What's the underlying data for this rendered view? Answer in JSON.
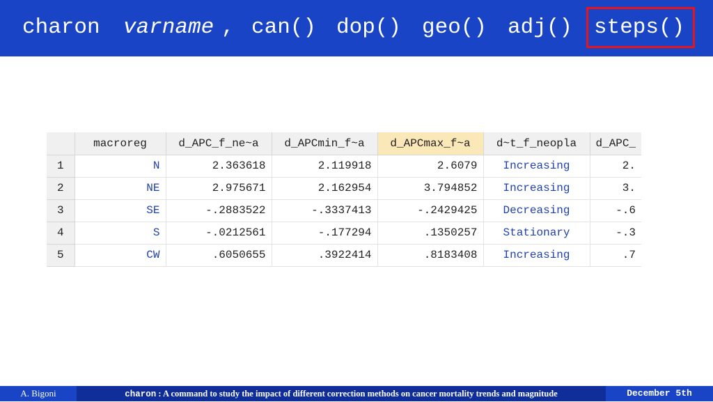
{
  "header": {
    "command": "charon",
    "varname": "varname",
    "comma": ",",
    "options": [
      "can()",
      "dop()",
      "geo()",
      "adj()",
      "steps()"
    ],
    "highlighted_option": "steps()",
    "highlight_color": "#e8141c",
    "background_color": "#1a44c6"
  },
  "table": {
    "columns": [
      "macroreg",
      "d_APC_f_ne~a",
      "d_APCmin_f~a",
      "d_APCmax_f~a",
      "d~t_f_neopla",
      "d_APC_"
    ],
    "selected_column": "d_APCmax_f~a",
    "rows": [
      {
        "num": "1",
        "macroreg": "N",
        "c1": "2.363618",
        "c2": "2.119918",
        "c3": "2.6079",
        "trend": "Increasing",
        "c5": "2."
      },
      {
        "num": "2",
        "macroreg": "NE",
        "c1": "2.975671",
        "c2": "2.162954",
        "c3": "3.794852",
        "trend": "Increasing",
        "c5": "3."
      },
      {
        "num": "3",
        "macroreg": "SE",
        "c1": "-.2883522",
        "c2": "-.3337413",
        "c3": "-.2429425",
        "trend": "Decreasing",
        "c5": "-.6"
      },
      {
        "num": "4",
        "macroreg": "S",
        "c1": "-.0212561",
        "c2": "-.177294",
        "c3": ".1350257",
        "trend": "Stationary",
        "c5": "-.3"
      },
      {
        "num": "5",
        "macroreg": "CW",
        "c1": ".6050655",
        "c2": ".3922414",
        "c3": ".8183408",
        "trend": "Increasing",
        "c5": ".7"
      }
    ]
  },
  "footer": {
    "author": "A. Bigoni",
    "title_cmd": "charon",
    "title_rest": " : A command to study the impact of different correction methods on cancer mortality trends and magnitude",
    "date": "December 5th"
  }
}
